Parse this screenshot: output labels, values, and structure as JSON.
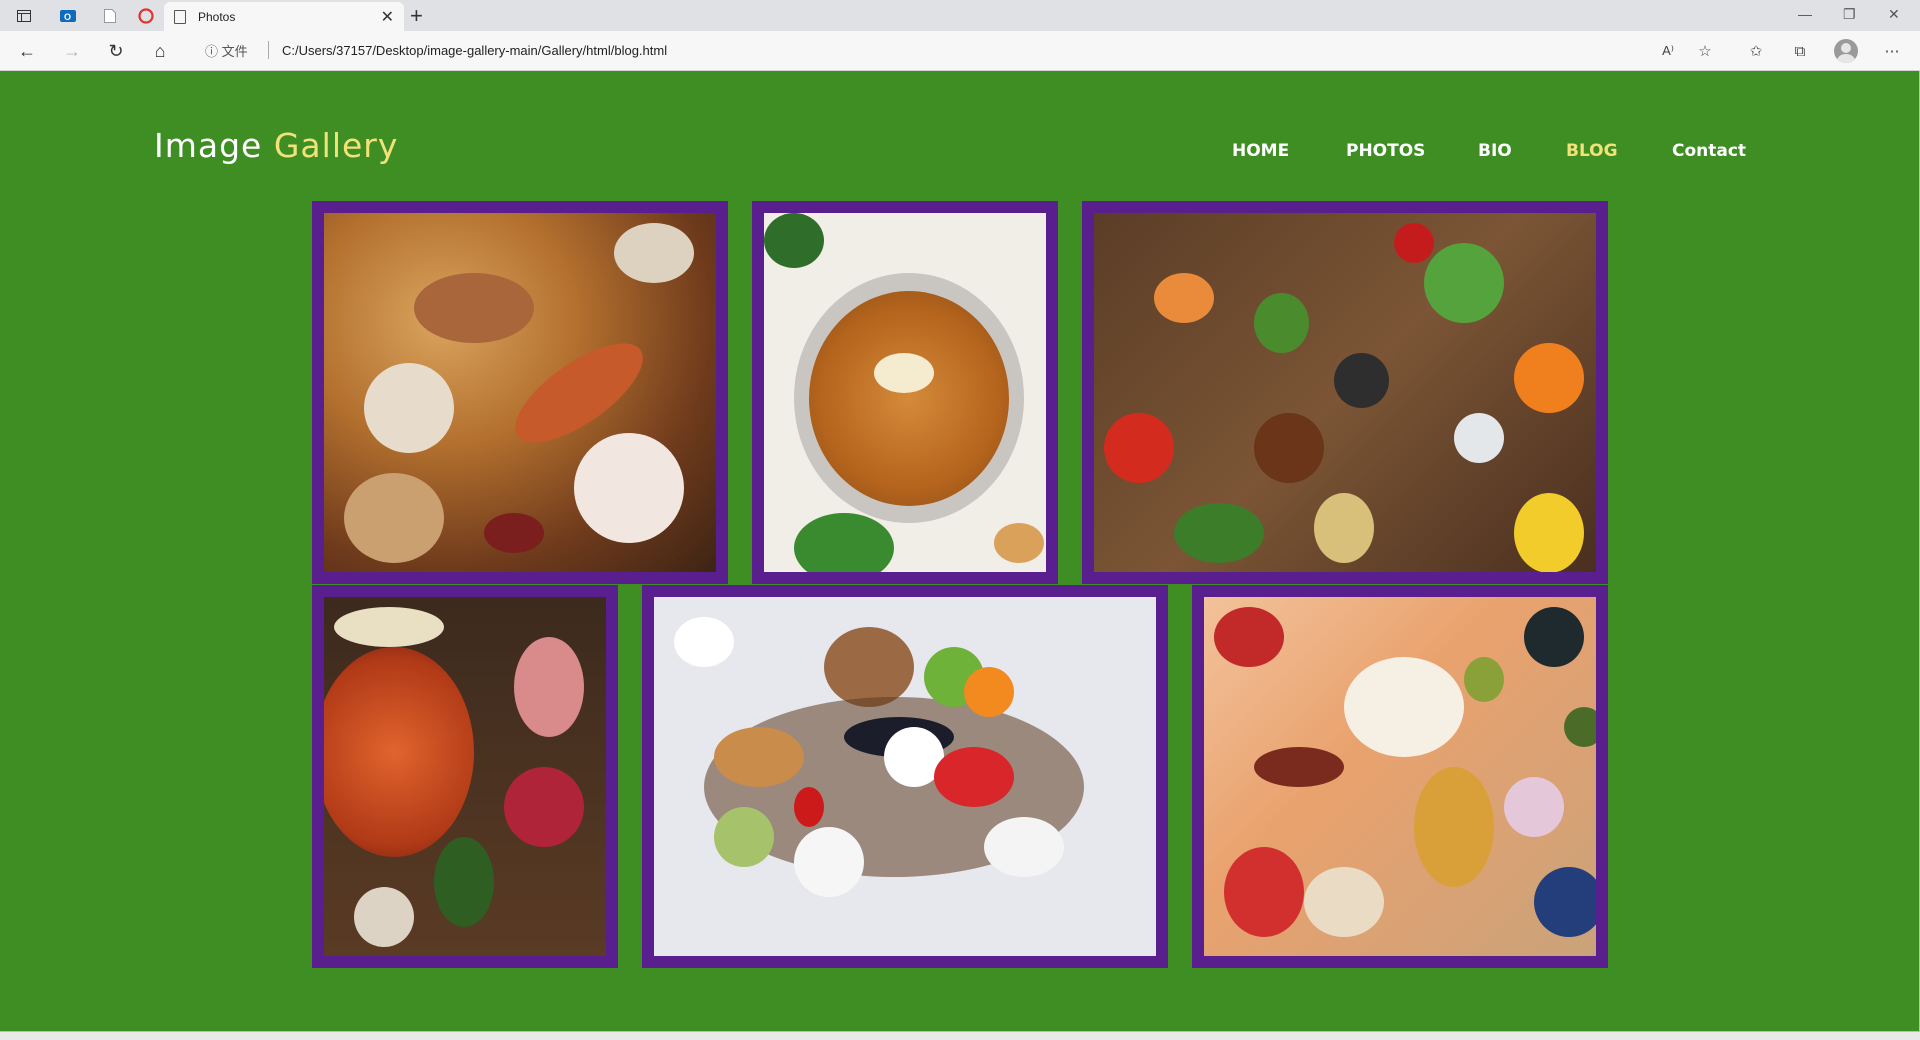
{
  "browser": {
    "tab_title": "Photos",
    "url_label": "文件",
    "url": "C:/Users/37157/Desktop/image-gallery-main/Gallery/html/blog.html",
    "reader_label": "A⁾"
  },
  "site": {
    "logo_main": "Image",
    "logo_accent": "Gallery",
    "nav": [
      "HOME",
      "PHOTOS",
      "BIO",
      "BLOG",
      "Contact"
    ],
    "active_nav": "BLOG"
  },
  "gallery": {
    "photos": [
      {
        "id": "holiday-feast",
        "icon": "food-photo"
      },
      {
        "id": "stew-bowl",
        "icon": "food-photo"
      },
      {
        "id": "vegetables-spread",
        "icon": "food-photo"
      },
      {
        "id": "hotpot-meats",
        "icon": "food-photo"
      },
      {
        "id": "healthy-foods",
        "icon": "food-photo"
      },
      {
        "id": "fruits-donuts",
        "icon": "food-photo"
      }
    ]
  },
  "social": [
    "facebook-icon",
    "twitter-icon",
    "github-icon"
  ],
  "colors": {
    "page_bg": "#3e8e24",
    "frame": "#5a1f8f",
    "accent": "#f1e27a",
    "text": "#ffffff"
  }
}
